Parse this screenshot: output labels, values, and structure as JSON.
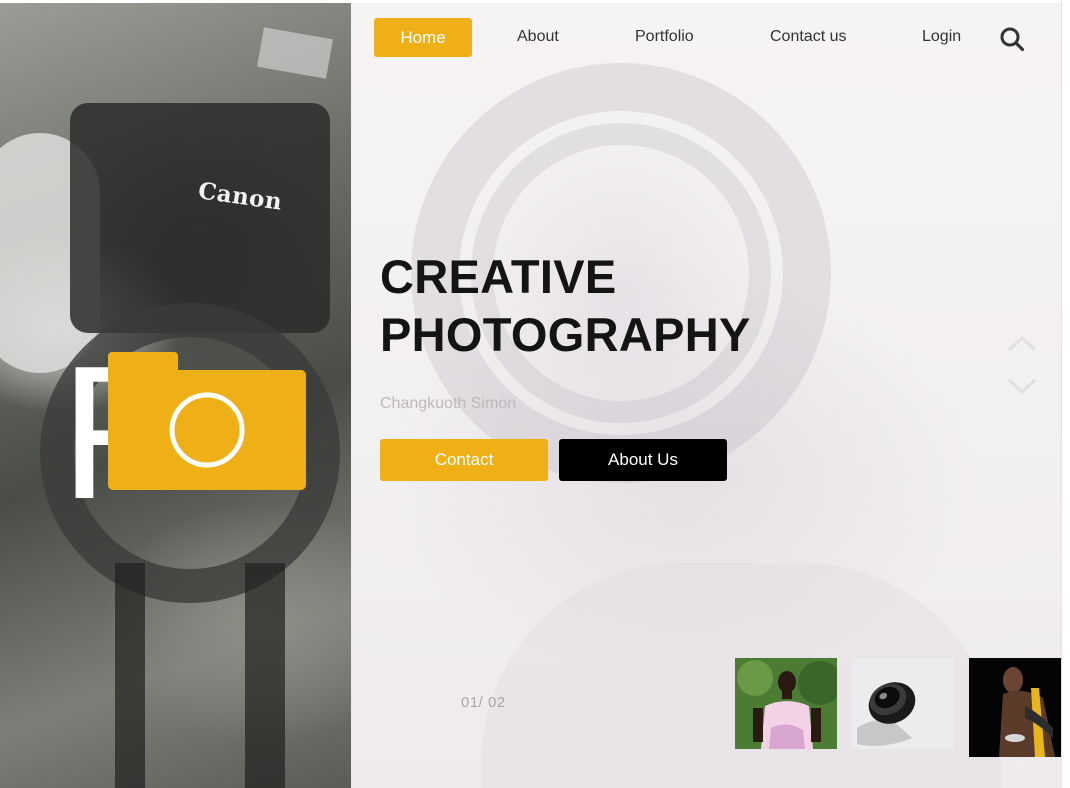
{
  "brand": {
    "logo_letter": "F",
    "accent_color": "#efb017",
    "logo_icon": "camera-icon"
  },
  "left_photo": {
    "camera_brand_text": "Canon"
  },
  "nav": {
    "home": "Home",
    "about": "About",
    "portfolio": "Portfolio",
    "contact": "Contact us",
    "login": "Login",
    "search_icon": "search-icon"
  },
  "hero": {
    "title_line1": "CREATIVE",
    "title_line2": "PHOTOGRAPHY",
    "subtitle": "Changkuoth Simon",
    "contact_button": "Contact",
    "about_button": "About Us"
  },
  "slider": {
    "counter": "01/ 02",
    "up_icon": "chevron-up-icon",
    "down_icon": "chevron-down-icon"
  },
  "thumbnails": [
    {
      "subject": "person-in-pink-shirt"
    },
    {
      "subject": "camera-lens"
    },
    {
      "subject": "person-with-yellow-bag"
    }
  ]
}
